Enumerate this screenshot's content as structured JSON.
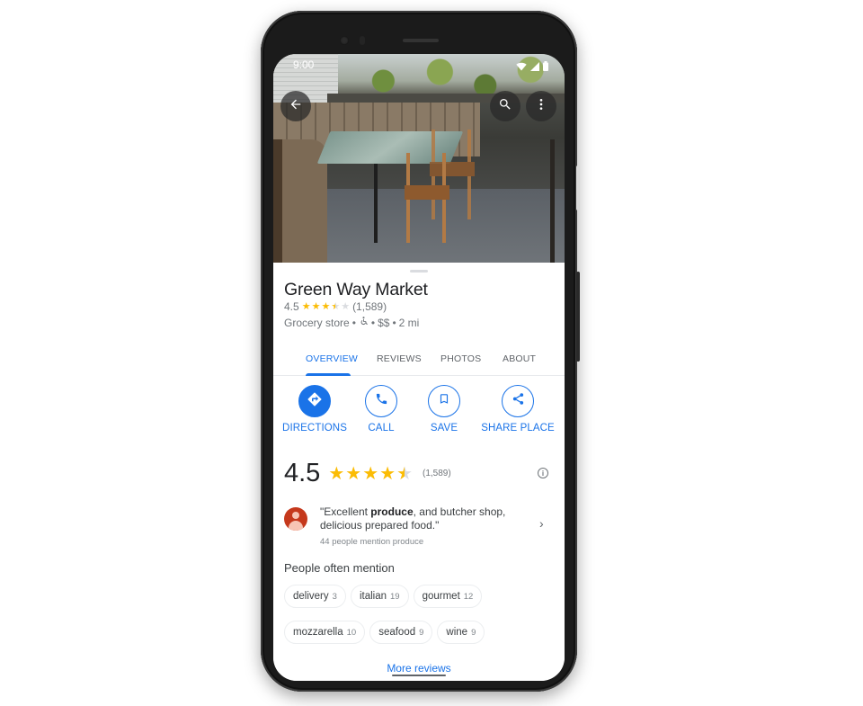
{
  "status_bar": {
    "time": "9:00"
  },
  "top_bar": {
    "back_icon": "arrow-back-icon",
    "search_icon": "search-icon",
    "more_icon": "more-vert-icon"
  },
  "place": {
    "name": "Green Way Market",
    "rating": "4.5",
    "rating_value": 4.5,
    "review_count": "(1,589)",
    "category": "Grocery store",
    "accessibility_icon": "wheelchair-icon",
    "separator": "•",
    "price": "$$",
    "distance": "2 mi"
  },
  "tabs": [
    {
      "label": "OVERVIEW",
      "active": true
    },
    {
      "label": "REVIEWS",
      "active": false
    },
    {
      "label": "PHOTOS",
      "active": false
    },
    {
      "label": "ABOUT",
      "active": false
    }
  ],
  "actions": [
    {
      "label": "DIRECTIONS",
      "icon": "directions-icon",
      "primary": true
    },
    {
      "label": "CALL",
      "icon": "phone-icon",
      "primary": false
    },
    {
      "label": "SAVE",
      "icon": "bookmark-icon",
      "primary": false
    },
    {
      "label": "SHARE PLACE",
      "icon": "share-icon",
      "primary": false
    }
  ],
  "rating_summary": {
    "score": "4.5",
    "count": "(1,589)",
    "info_icon": "info-icon"
  },
  "review_highlight": {
    "quote_start": "\"Excellent ",
    "quote_bold": "produce",
    "quote_end": ", and butcher shop, delicious prepared food.\"",
    "mention_count": "44 people mention produce"
  },
  "people_often_mention": {
    "title": "People often mention",
    "chips": [
      {
        "label": "delivery",
        "count": "3"
      },
      {
        "label": "italian",
        "count": "19"
      },
      {
        "label": "gourmet",
        "count": "12"
      },
      {
        "label": "mozzarella",
        "count": "10"
      },
      {
        "label": "seafood",
        "count": "9"
      },
      {
        "label": "wine",
        "count": "9"
      }
    ]
  },
  "more_reviews_label": "More reviews",
  "colors": {
    "accent": "#1a73e8",
    "star": "#fbbc04",
    "avatar": "#c5381c",
    "text_primary": "#202124",
    "text_secondary": "#70757a"
  }
}
